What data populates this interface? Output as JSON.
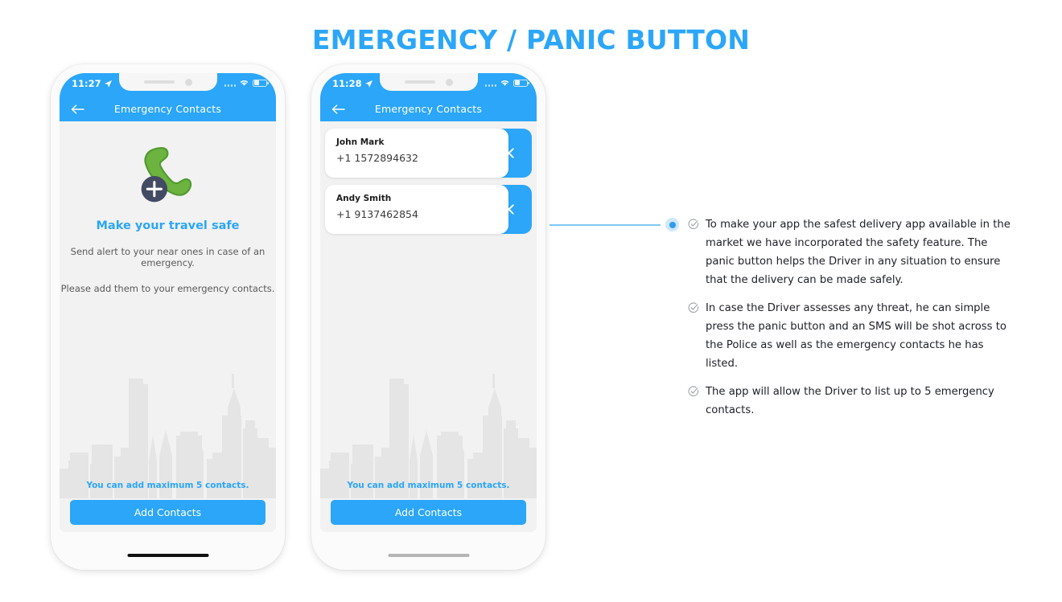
{
  "title": "EMERGENCY / PANIC BUTTON",
  "colors": {
    "accent_blue": "#2BA6F8",
    "connector_blue": "#7fc8f5",
    "handset_green": "#6CB33F",
    "plus_circle": "#434A63",
    "screen_bg": "#f2f2f2",
    "skyline_gray": "#e6e6e6",
    "text_dark": "#20222b"
  },
  "phones": [
    {
      "id": "phone-empty-state",
      "status": {
        "time": "11:27",
        "location_icon": "location-arrow-icon",
        "signal_icon": "signal-dots-icon",
        "wifi_icon": "wifi-icon",
        "battery_icon": "battery-icon"
      },
      "nav": {
        "back_icon": "back-arrow-icon",
        "title": "Emergency Contacts"
      },
      "empty_state": {
        "illustration": "phone-add-contact-icon",
        "headline": "Make your travel safe",
        "line1": "Send alert to your near ones in case of an emergency.",
        "line2": "Please add them to your emergency contacts."
      },
      "hint": "You can add maximum 5 contacts.",
      "cta_label": "Add Contacts",
      "home_indicator": "dark"
    },
    {
      "id": "phone-contacts-list",
      "status": {
        "time": "11:28",
        "location_icon": "location-arrow-icon",
        "signal_icon": "signal-dots-icon",
        "wifi_icon": "wifi-icon",
        "battery_icon": "battery-icon"
      },
      "nav": {
        "back_icon": "back-arrow-icon",
        "title": "Emergency Contacts"
      },
      "contacts": [
        {
          "name": "John Mark",
          "phone": "+1 1572894632",
          "delete_icon": "close-x-icon"
        },
        {
          "name": "Andy Smith",
          "phone": "+1 9137462854",
          "delete_icon": "close-x-icon"
        }
      ],
      "hint": "You can add maximum 5 contacts.",
      "cta_label": "Add Contacts",
      "home_indicator": "gray"
    }
  ],
  "bullets": [
    {
      "icon": "check-circle-icon",
      "text": "To make your app the safest delivery app available in the market we have incorporated the safety feature. The panic button helps the Driver in any situation to ensure that the delivery can be made safely."
    },
    {
      "icon": "check-circle-icon",
      "text": "In case the Driver assesses any threat, he can simple press the panic button and an SMS will be shot across to the Police as well as the emergency contacts he has listed."
    },
    {
      "icon": "check-circle-icon",
      "text": "The app will allow the Driver to list up to 5 emergency contacts."
    }
  ]
}
